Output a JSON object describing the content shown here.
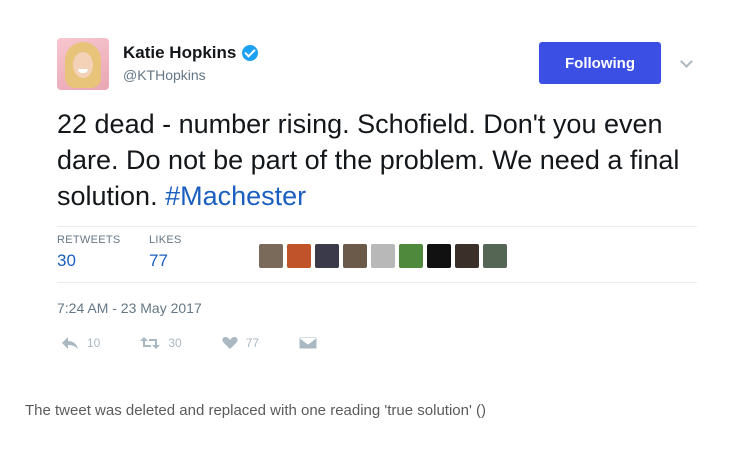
{
  "tweet": {
    "author_name": "Katie Hopkins",
    "author_handle": "@KTHopkins",
    "follow_button_label": "Following",
    "text_before_hashtag": "22 dead - number rising. Schofield. Don't you even dare. Do not be part of the problem. We need a final solution. ",
    "hashtag": "#Machester",
    "retweets_label": "RETWEETS",
    "retweets_count": "30",
    "likes_label": "LIKES",
    "likes_count": "77",
    "timestamp": "7:24 AM - 23 May 2017",
    "actions": {
      "reply_count": "10",
      "retweet_count": "30",
      "like_count": "77"
    },
    "liker_avatar_colors": [
      "#7a6a5a",
      "#c0532a",
      "#3a3a4a",
      "#6b5a4a",
      "#b8b8b8",
      "#4f8a3c",
      "#111111",
      "#3b2f2a",
      "#556655"
    ]
  },
  "caption": "The tweet was deleted and replaced with one reading 'true solution' ()",
  "colors": {
    "follow_button": "#3b4fe4",
    "link_blue": "#1b5fbf",
    "muted_gray": "#657786"
  }
}
